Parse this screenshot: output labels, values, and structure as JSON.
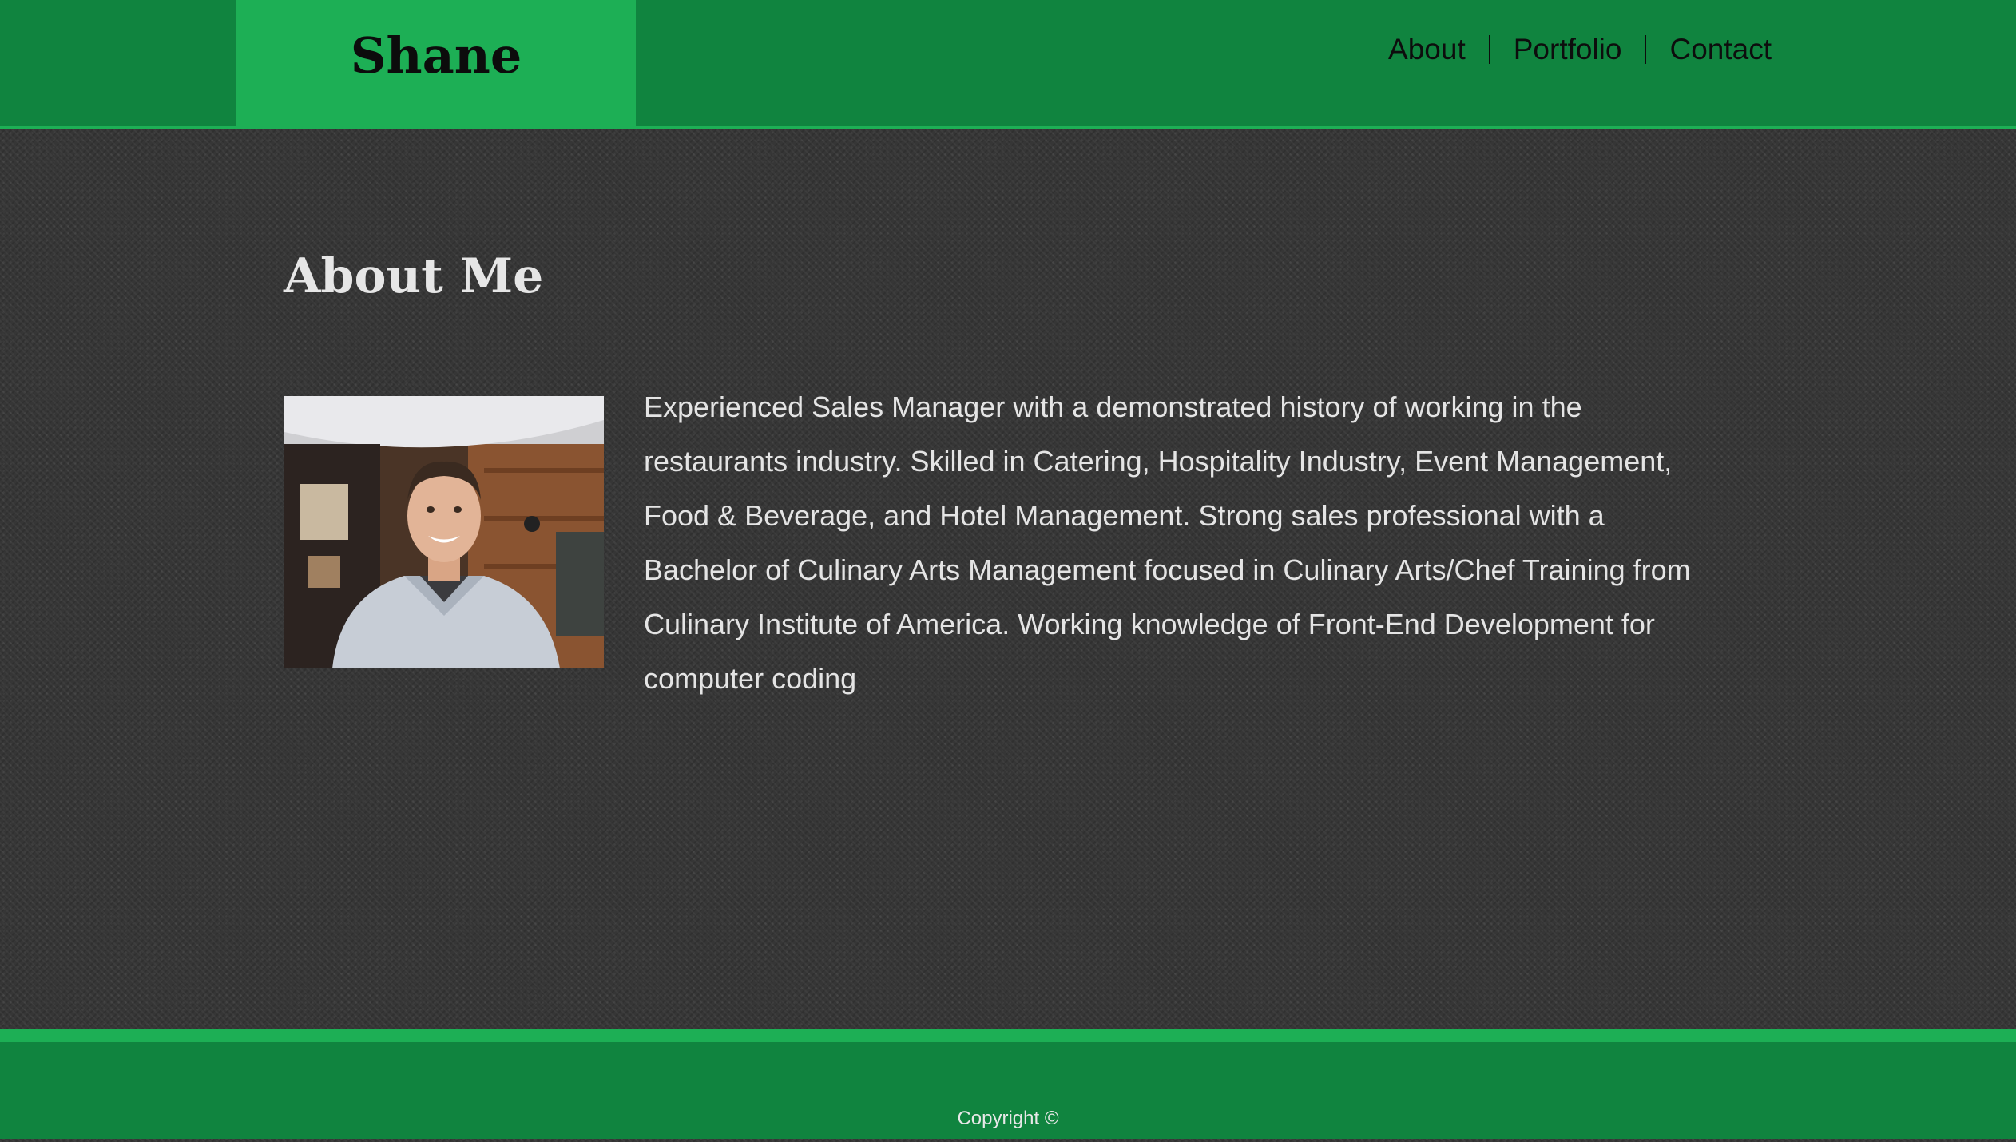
{
  "header": {
    "brand": "Shane",
    "nav": {
      "about": "About",
      "portfolio": "Portfolio",
      "contact": "Contact"
    }
  },
  "main": {
    "title": "About Me",
    "bio": "Experienced Sales Manager with a demonstrated history of working in the restaurants industry. Skilled in Catering, Hospitality Industry, Event Management, Food & Beverage, and Hotel Management. Strong sales professional with a Bachelor of Culinary Arts Management focused in Culinary Arts/Chef Training from Culinary Institute of America. Working knowledge of Front-End Development for computer coding"
  },
  "footer": {
    "copyright": "Copyright ©"
  },
  "colors": {
    "header_green": "#10843f",
    "accent_green": "#1daf55",
    "background_dark": "#363636",
    "text_light": "#e4e4e4"
  }
}
